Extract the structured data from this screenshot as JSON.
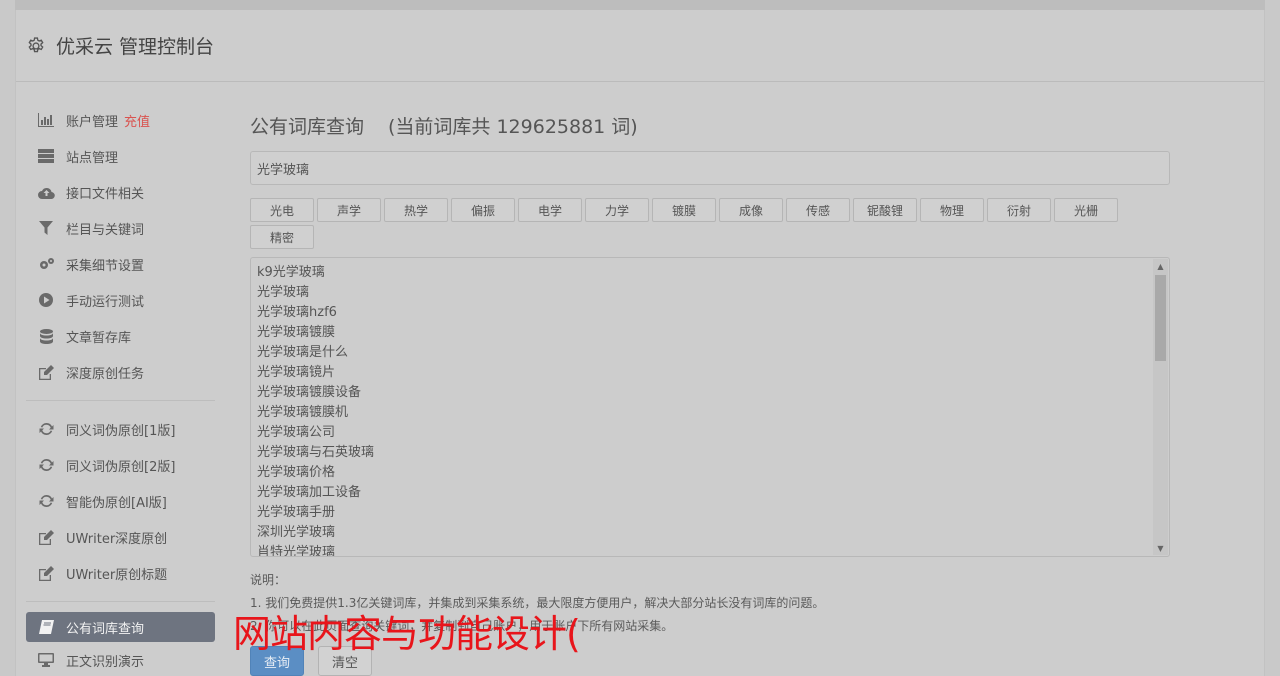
{
  "app": {
    "title": "优采云 管理控制台"
  },
  "sidebar": {
    "groups": [
      [
        {
          "label": "账户管理",
          "tag": "充值",
          "icon": "bar-chart-icon"
        },
        {
          "label": "站点管理",
          "icon": "server-icon"
        },
        {
          "label": "接口文件相关",
          "icon": "cloud-upload-icon"
        },
        {
          "label": "栏目与关键词",
          "icon": "filter-icon"
        },
        {
          "label": "采集细节设置",
          "icon": "gears-icon"
        },
        {
          "label": "手动运行测试",
          "icon": "play-circle-icon"
        },
        {
          "label": "文章暂存库",
          "icon": "database-icon"
        },
        {
          "label": "深度原创任务",
          "icon": "edit-icon"
        }
      ],
      [
        {
          "label": "同义词伪原创[1版]",
          "icon": "refresh-icon"
        },
        {
          "label": "同义词伪原创[2版]",
          "icon": "refresh-icon"
        },
        {
          "label": "智能伪原创[AI版]",
          "icon": "refresh-icon"
        },
        {
          "label": "UWriter深度原创",
          "icon": "edit-icon"
        },
        {
          "label": "UWriter原创标题",
          "icon": "edit-icon"
        }
      ],
      [
        {
          "label": "公有词库查询",
          "icon": "book-icon",
          "active": true
        },
        {
          "label": "正文识别演示",
          "icon": "monitor-icon"
        }
      ]
    ]
  },
  "main": {
    "title": "公有词库查询",
    "count_text": "(当前词库共 129625881 词)",
    "search_value": "光学玻璃",
    "chips": [
      "光电",
      "声学",
      "热学",
      "偏振",
      "电学",
      "力学",
      "镀膜",
      "成像",
      "传感",
      "铌酸锂",
      "物理",
      "衍射",
      "光栅",
      "精密"
    ],
    "results": [
      "k9光学玻璃",
      "光学玻璃",
      "光学玻璃hzf6",
      "光学玻璃镀膜",
      "光学玻璃是什么",
      "光学玻璃镜片",
      "光学玻璃镀膜设备",
      "光学玻璃镀膜机",
      "光学玻璃公司",
      "光学玻璃与石英玻璃",
      "光学玻璃价格",
      "光学玻璃加工设备",
      "光学玻璃手册",
      "深圳光学玻璃",
      "肖特光学玻璃"
    ],
    "notes": {
      "heading": "说明：",
      "line1": "1. 我们免费提供1.3亿关键词库，并集成到采集系统，最大限度方便用户，解决大部分站长没有词库的问题。",
      "line2": "2. 你可以在此页面查询关键词，并复制到自己账户，用于账户下所有网站采集。"
    },
    "buttons": {
      "query": "查询",
      "clear": "清空"
    }
  },
  "overlay": {
    "text": "网站内容与功能设计("
  }
}
